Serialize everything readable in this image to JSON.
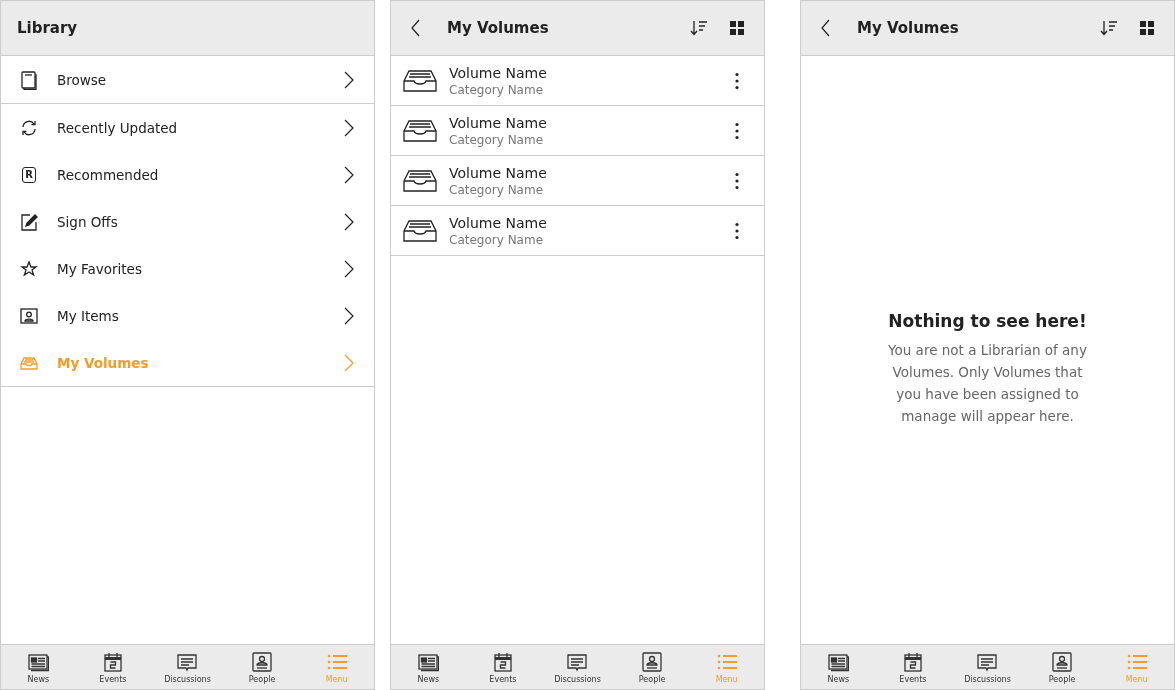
{
  "screens": [
    {
      "kind": "menu",
      "header": {
        "title": "Library"
      },
      "items": [
        {
          "label": "Browse",
          "selected": false
        },
        {
          "label": "Recently Updated",
          "selected": false
        },
        {
          "label": "Recommended",
          "badge": "R",
          "selected": false
        },
        {
          "label": "Sign Offs",
          "selected": false
        },
        {
          "label": "My Favorites",
          "selected": false
        },
        {
          "label": "My Items",
          "selected": false
        },
        {
          "label": "My Volumes",
          "selected": true
        }
      ],
      "tabs": [
        {
          "label": "News",
          "selected": false
        },
        {
          "label": "Events",
          "selected": false
        },
        {
          "label": "Discussions",
          "selected": false
        },
        {
          "label": "People",
          "selected": false
        },
        {
          "label": "Menu",
          "selected": true
        }
      ]
    },
    {
      "kind": "list",
      "header": {
        "title": "My Volumes"
      },
      "rows": [
        {
          "name": "Volume Name",
          "category": "Category Name"
        },
        {
          "name": "Volume Name",
          "category": "Category Name"
        },
        {
          "name": "Volume Name",
          "category": "Category Name"
        },
        {
          "name": "Volume Name",
          "category": "Category Name"
        }
      ],
      "tabs": [
        {
          "label": "News",
          "selected": false
        },
        {
          "label": "Events",
          "selected": false
        },
        {
          "label": "Discussions",
          "selected": false
        },
        {
          "label": "People",
          "selected": false
        },
        {
          "label": "Menu",
          "selected": true
        }
      ]
    },
    {
      "kind": "empty",
      "header": {
        "title": "My Volumes"
      },
      "empty": {
        "title": "Nothing to see here!",
        "message": "You are not a Librarian of any Volumes. Only Volumes that you have been assigned to manage will appear here."
      },
      "tabs": [
        {
          "label": "News",
          "selected": false
        },
        {
          "label": "Events",
          "selected": false
        },
        {
          "label": "Discussions",
          "selected": false
        },
        {
          "label": "People",
          "selected": false
        },
        {
          "label": "Menu",
          "selected": true
        }
      ]
    }
  ]
}
